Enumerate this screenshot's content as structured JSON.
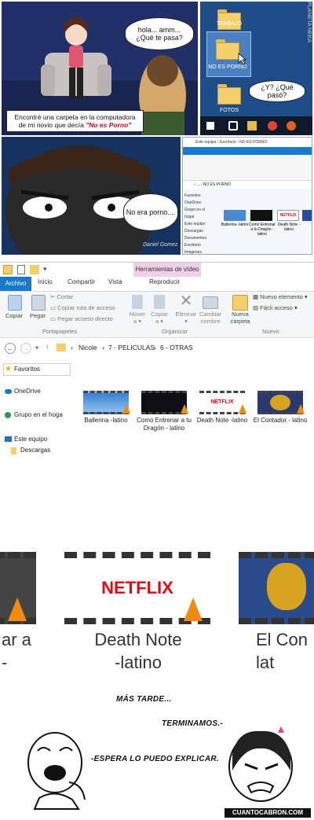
{
  "comic": {
    "panel1": {
      "bubble": "hola... amm...\n¿Qué te pasa?",
      "caption_prefix": "Encontré una carpeta en la computadora de mi novio que decía ",
      "caption_highlight": "\"No es Porno\""
    },
    "panel2": {
      "folders": [
        "TRABAJO",
        "NO ES PORNO",
        "FOTOS"
      ],
      "bubble": "¿Y? ¿Qué pasó?",
      "watermark": "PLANETA NEKA"
    },
    "panel3": {
      "bubble": "No era porno....",
      "signature": "Daniel Gomez"
    },
    "panel4": {
      "breadcrumb": "Este equipo › Escritorio › NO ES PORNO",
      "highlight": "NO ES PORNO",
      "files": [
        "Ballerina -latino",
        "Como Entrenar a tu Dragón -latino",
        "Death Note -latino",
        "El Contador -latino"
      ]
    }
  },
  "explorer": {
    "title_tab": "Herramientas de vídeo",
    "tabs": [
      "Archivo",
      "Inicio",
      "Compartir",
      "Vista",
      "Reproducir"
    ],
    "ribbon": {
      "copiar": "Copiar",
      "pegar": "Pegar",
      "cortar": "Cortar",
      "copiar_ruta": "Copiar ruta de acceso",
      "pegar_acceso": "Pegar acceso directo",
      "mover": "Mover\na ▾",
      "copiar_a": "Copiar\na ▾",
      "eliminar": "Eliminar\n▾",
      "cambiar": "Cambiar\nnombre",
      "nueva": "Nueva\ncarpeta",
      "nuevo_elemento": "Nuevo elemento ▾",
      "facil_acceso": "Fácil acceso ▾",
      "groups": [
        "Portapapeles",
        "Organizar",
        "Nuevo"
      ]
    },
    "path": [
      "Nicole",
      "7 - PELICULAS",
      "6 - OTRAS"
    ],
    "nav": [
      "Favoritos",
      "OneDrive",
      "Grupo en el hoga",
      "Este equipo",
      "Descargas"
    ],
    "files": [
      {
        "name": "Ballerina -latino"
      },
      {
        "name": "Como Entrenar a tu Dragón - latino"
      },
      {
        "name": "Death Note -latino"
      },
      {
        "name": "El Contador - latino"
      }
    ],
    "netflix": "NETFLIX"
  },
  "zoom": {
    "left_label": "ar a\n-",
    "center_label": "Death Note\n-latino",
    "right_label": "El Con\nlat",
    "netflix": "NETFLIX"
  },
  "bottom": {
    "line1": "MÁS TARDE...",
    "line2": "TERMINAMOS.-",
    "line3": "-ESPERA LO PUEDO EXPLICAR.",
    "site": "CUANTOCABRON.COM"
  },
  "colors": {
    "ribbon_accent": "#1979ca",
    "video_tools": "#f0d0e8",
    "netflix_red": "#e50914",
    "folder": "#f4cf6c"
  }
}
